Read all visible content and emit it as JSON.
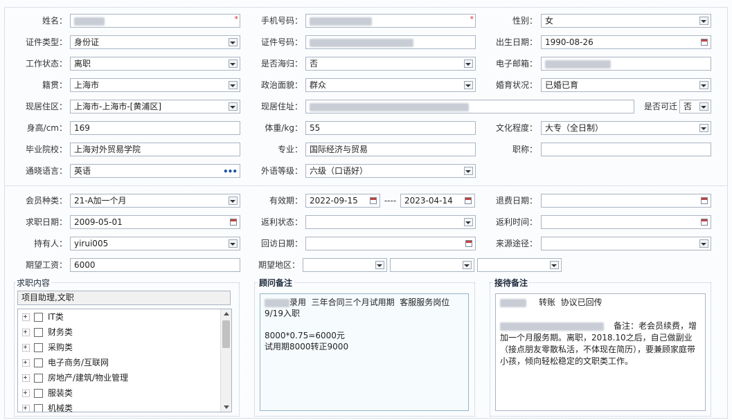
{
  "basic": {
    "name_label": "姓名：",
    "phone_label": "手机号码：",
    "gender_label": "性别：",
    "gender_value": "女",
    "idtype_label": "证件类型：",
    "idtype_value": "身份证",
    "idno_label": "证件号码：",
    "birth_label": "出生日期：",
    "birth_value": "1990-08-26",
    "workstatus_label": "工作状态：",
    "workstatus_value": "离职",
    "overseas_label": "是否海归：",
    "overseas_value": "否",
    "email_label": "电子邮箱：",
    "native_label": "籍贯：",
    "native_value": "上海市",
    "political_label": "政治面貌：",
    "political_value": "群众",
    "marital_label": "婚育状况：",
    "marital_value": "已婚已育",
    "residence_area_label": "现居住区：",
    "residence_area_value": "上海市-上海市-[黄浦区]",
    "address_label": "现居住址：",
    "relocate_label": "是否可迁",
    "relocate_value": "否",
    "height_label": "身高/cm：",
    "height_value": "169",
    "weight_label": "体重/kg：",
    "weight_value": "55",
    "education_label": "文化程度：",
    "education_value": "大专（全日制）",
    "school_label": "毕业院校：",
    "school_value": "上海对外贸易学院",
    "major_label": "专业：",
    "major_value": "国际经济与贸易",
    "title_label": "职称：",
    "title_value": "",
    "language_label": "通晓语言：",
    "language_value": "英语",
    "language_more": "•••",
    "lang_level_label": "外语等级：",
    "lang_level_value": "六级（口语好）"
  },
  "member": {
    "type_label": "会员种类：",
    "type_value": "21-A加一个月",
    "validity_label": "有效期：",
    "valid_from": "2022-09-15",
    "valid_sep": "----",
    "valid_to": "2023-04-14",
    "refund_date_label": "退费日期：",
    "refund_date_value": "",
    "jobseek_date_label": "求职日期：",
    "jobseek_date_value": "2009-05-01",
    "rebate_status_label": "返利状态：",
    "rebate_status_value": "",
    "rebate_time_label": "返利时间：",
    "rebate_time_value": "",
    "holder_label": "持有人：",
    "holder_value": "yirui005",
    "revisit_label": "回访日期：",
    "revisit_value": "",
    "source_label": "来源途径：",
    "source_value": "",
    "salary_label": "期望工资：",
    "salary_value": "6000",
    "region_label": "期望地区：",
    "region1": "",
    "region2": "",
    "region3": ""
  },
  "job_content": {
    "title": "求职内容",
    "selected": "项目助理,文职",
    "tree": [
      "IT类",
      "财务类",
      "采购类",
      "电子商务/互联网",
      "房地产/建筑/物业管理",
      "服装类",
      "机械类"
    ]
  },
  "advisor_notes": {
    "title": "顾问备注",
    "text": "录用  三年合同三个月试用期  客服服务岗位\n9/19入职\n\n8000*0.75=6000元\n试用期8000转正9000"
  },
  "reception_notes": {
    "title": "接待备注",
    "line1": "转账  协议已回传",
    "text": "备注：老会员续费，增加一个月服务期。离职，2018.10之后，自己做副业（接点朋友零散私活，不体现在简历），要兼顾家庭带小孩，倾向轻松稳定的文职类工作。"
  },
  "colors": {
    "border": "#a9b4c2",
    "label": "#333333",
    "required": "#dd2222"
  }
}
